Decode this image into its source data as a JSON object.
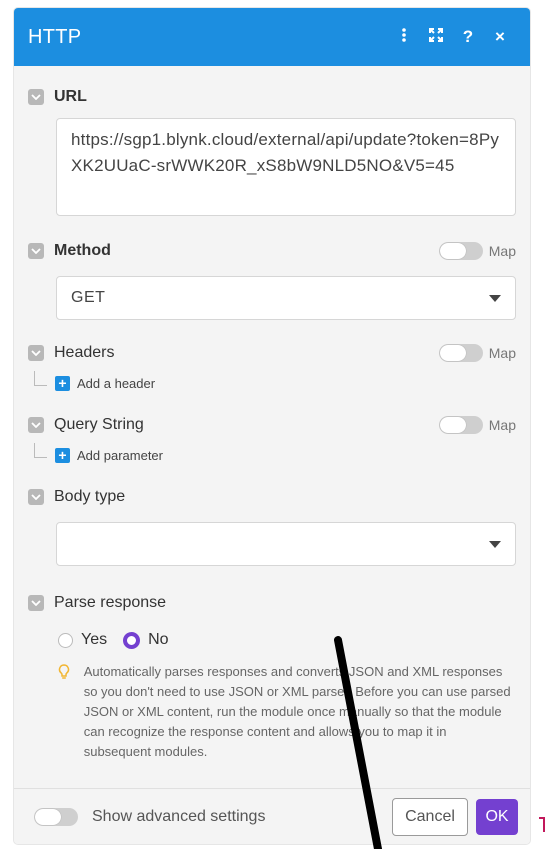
{
  "header": {
    "title": "HTTP",
    "menu_icon": "more-vertical-icon",
    "expand_icon": "expand-icon",
    "help_label": "?",
    "close_label": "×"
  },
  "url": {
    "label": "URL",
    "value": "https://sgp1.blynk.cloud/external/api/update?token=8PyXK2UUaC-srWWK20R_xS8bW9NLD5NO&V5=45"
  },
  "method": {
    "label": "Method",
    "map_label": "Map",
    "value": "GET"
  },
  "headers": {
    "label": "Headers",
    "map_label": "Map",
    "add_label": "Add a header"
  },
  "query_string": {
    "label": "Query String",
    "map_label": "Map",
    "add_label": "Add parameter"
  },
  "body_type": {
    "label": "Body type",
    "value": ""
  },
  "parse_response": {
    "label": "Parse response",
    "options": [
      "Yes",
      "No"
    ],
    "selected": "No",
    "hint": "Automatically parses responses and converts JSON and XML responses so you don't need to use JSON or XML parser. Before you can use parsed JSON or XML content, run the module once manually so that the module can recognize the response content and allows you to map it in subsequent modules."
  },
  "footer": {
    "advanced_label": "Show advanced settings",
    "cancel_label": "Cancel",
    "ok_label": "OK"
  },
  "colors": {
    "header": "#1c8ee0",
    "accent": "#7440d0",
    "panel_bg": "#f4f4f4"
  }
}
